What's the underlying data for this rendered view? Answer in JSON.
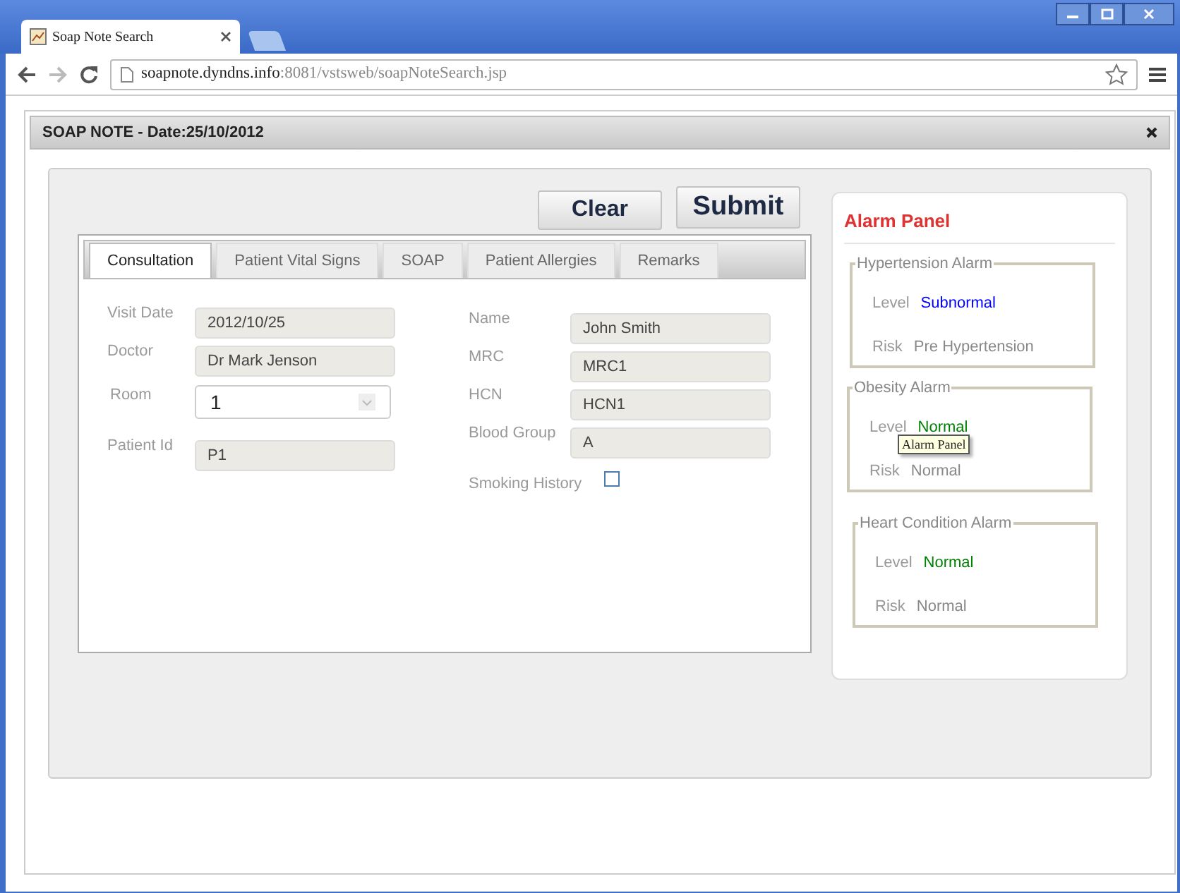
{
  "browser": {
    "tab_title": "Soap Note Search",
    "url_host": "soapnote.dyndns.info",
    "url_rest": ":8081/vstsweb/soapNoteSearch.jsp"
  },
  "dialog": {
    "title": "SOAP NOTE - Date:25/10/2012"
  },
  "buttons": [
    "Clear",
    "Submit"
  ],
  "tabs": [
    {
      "label": "Consultation",
      "selected": true
    },
    {
      "label": "Patient Vital Signs",
      "selected": false
    },
    {
      "label": "SOAP",
      "selected": false
    },
    {
      "label": "Patient Allergies",
      "selected": false
    },
    {
      "label": "Remarks",
      "selected": false
    }
  ],
  "left_fields": [
    {
      "kind": "text",
      "label": "Visit Date",
      "value": "2012/10/25"
    },
    {
      "kind": "text",
      "label": "Doctor",
      "value": "Dr Mark Jenson"
    },
    {
      "kind": "select",
      "label": "Room",
      "value": "1"
    },
    {
      "kind": "text",
      "label": "Patient Id",
      "value": "P1"
    }
  ],
  "right_fields": [
    {
      "kind": "text",
      "label": "Name",
      "value": "John Smith"
    },
    {
      "kind": "text",
      "label": "MRC",
      "value": "MRC1"
    },
    {
      "kind": "text",
      "label": "HCN",
      "value": "HCN1"
    },
    {
      "kind": "text",
      "label": "Blood Group",
      "value": "A"
    },
    {
      "kind": "checkbox",
      "label": "Smoking History",
      "checked": false
    }
  ],
  "alarm_panel": {
    "title": "Alarm Panel",
    "alarms": [
      {
        "title": "Hypertension Alarm",
        "level_label": "Level",
        "level": "Subnormal",
        "color": "#0000ff",
        "risk_label": "Risk",
        "risk": "Pre Hypertension"
      },
      {
        "title": "Obesity Alarm",
        "level_label": "Level",
        "level": "Normal",
        "color": "#008000",
        "risk_label": "Risk",
        "risk": "Normal"
      },
      {
        "title": "Heart Condition Alarm",
        "level_label": "Level",
        "level": "Normal",
        "color": "#008000",
        "risk_label": "Risk",
        "risk": "Normal"
      }
    ],
    "tooltip": "Alarm Panel"
  }
}
